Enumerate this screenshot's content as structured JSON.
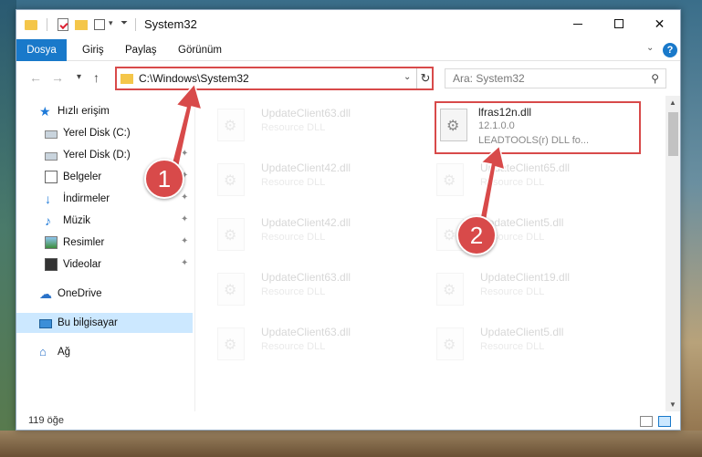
{
  "window": {
    "title": "System32",
    "controls": {
      "minimize": "–",
      "maximize": "",
      "close": "✕"
    }
  },
  "ribbon": {
    "tabs": [
      {
        "label": "Dosya",
        "active": true
      },
      {
        "label": "Giriş"
      },
      {
        "label": "Paylaş"
      },
      {
        "label": "Görünüm"
      }
    ],
    "help_label": "?"
  },
  "address": {
    "path": "C:\\Windows\\System32",
    "refresh_icon": "↻"
  },
  "search": {
    "placeholder": "Ara: System32",
    "icon": "⚲"
  },
  "sidebar": {
    "items": [
      {
        "label": "Hızlı erişim",
        "icon": "star-icon",
        "pinned": false
      },
      {
        "label": "Yerel Disk (C:)",
        "icon": "disk-icon",
        "pinned": true
      },
      {
        "label": "Yerel Disk (D:)",
        "icon": "disk-icon",
        "pinned": true
      },
      {
        "label": "Belgeler",
        "icon": "documents-icon",
        "pinned": true
      },
      {
        "label": "İndirmeler",
        "icon": "download-icon",
        "pinned": true
      },
      {
        "label": "Müzik",
        "icon": "music-icon",
        "pinned": true
      },
      {
        "label": "Resimler",
        "icon": "pictures-icon",
        "pinned": true
      },
      {
        "label": "Videolar",
        "icon": "videos-icon",
        "pinned": true
      },
      {
        "label": "OneDrive",
        "icon": "cloud-icon"
      },
      {
        "label": "Bu bilgisayar",
        "icon": "computer-icon",
        "selected": true
      },
      {
        "label": "Ağ",
        "icon": "network-icon"
      }
    ],
    "pin_glyph": "📌"
  },
  "files": [
    {
      "name": "UpdateClient63.dll",
      "desc": "Resource DLL",
      "faded": true
    },
    {
      "name": "lfras12n.dll",
      "desc": "12.1.0.0",
      "desc2": "LEADTOOLS(r) DLL fo...",
      "highlighted": true
    },
    {
      "name": "UpdateClient42.dll",
      "desc": "Resource DLL",
      "faded": true
    },
    {
      "name": "UpdateClient65.dll",
      "desc": "Resource DLL",
      "faded": true
    },
    {
      "name": "UpdateClient42.dll",
      "desc": "Resource DLL",
      "faded": true
    },
    {
      "name": "UpdateClient5.dll",
      "desc": "Resource DLL",
      "faded": true
    },
    {
      "name": "UpdateClient63.dll",
      "desc": "Resource DLL",
      "faded": true
    },
    {
      "name": "UpdateClient19.dll",
      "desc": "Resource DLL",
      "faded": true
    },
    {
      "name": "UpdateClient63.dll",
      "desc": "Resource DLL",
      "faded": true
    },
    {
      "name": "UpdateClient5.dll",
      "desc": "Resource DLL",
      "faded": true
    }
  ],
  "status": {
    "item_count": "119 öğe"
  },
  "annotations": {
    "step1": "1",
    "step2": "2",
    "color": "#d84a4a"
  }
}
